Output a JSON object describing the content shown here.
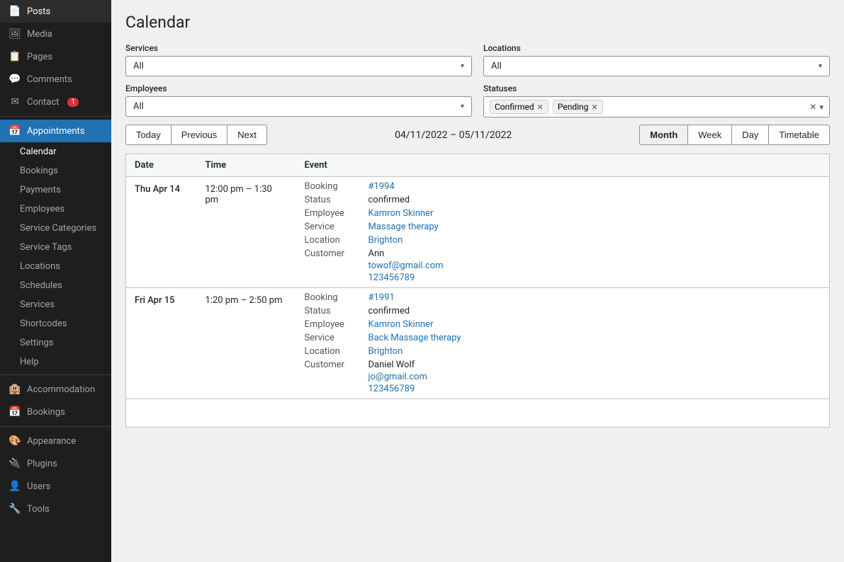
{
  "sidebar": {
    "items": [
      {
        "id": "posts",
        "label": "Posts",
        "icon": "📄",
        "active": false
      },
      {
        "id": "media",
        "label": "Media",
        "icon": "🖼",
        "active": false
      },
      {
        "id": "pages",
        "label": "Pages",
        "icon": "📋",
        "active": false
      },
      {
        "id": "comments",
        "label": "Comments",
        "icon": "💬",
        "active": false
      },
      {
        "id": "contact",
        "label": "Contact",
        "icon": "✉",
        "badge": "1",
        "active": false
      },
      {
        "id": "appointments",
        "label": "Appointments",
        "icon": "📅",
        "active": true
      }
    ],
    "appointments_sub": [
      {
        "id": "calendar",
        "label": "Calendar",
        "active": true
      },
      {
        "id": "bookings",
        "label": "Bookings",
        "active": false
      },
      {
        "id": "payments",
        "label": "Payments",
        "active": false
      },
      {
        "id": "employees",
        "label": "Employees",
        "active": false
      },
      {
        "id": "service-categories",
        "label": "Service Categories",
        "active": false
      },
      {
        "id": "service-tags",
        "label": "Service Tags",
        "active": false
      },
      {
        "id": "locations",
        "label": "Locations",
        "active": false
      },
      {
        "id": "schedules",
        "label": "Schedules",
        "active": false
      },
      {
        "id": "services",
        "label": "Services",
        "active": false
      },
      {
        "id": "shortcodes",
        "label": "Shortcodes",
        "active": false
      },
      {
        "id": "settings",
        "label": "Settings",
        "active": false
      },
      {
        "id": "help",
        "label": "Help",
        "active": false
      }
    ],
    "bottom_items": [
      {
        "id": "accommodation",
        "label": "Accommodation",
        "icon": "🏨"
      },
      {
        "id": "bookings2",
        "label": "Bookings",
        "icon": "📅"
      },
      {
        "id": "appearance",
        "label": "Appearance",
        "icon": "🎨"
      },
      {
        "id": "plugins",
        "label": "Plugins",
        "icon": "🔌"
      },
      {
        "id": "users",
        "label": "Users",
        "icon": "👤"
      },
      {
        "id": "tools",
        "label": "Tools",
        "icon": "🔧"
      }
    ]
  },
  "page": {
    "title": "Calendar"
  },
  "filters": {
    "services_label": "Services",
    "services_value": "All",
    "locations_label": "Locations",
    "locations_value": "All",
    "employees_label": "Employees",
    "employees_value": "All",
    "statuses_label": "Statuses",
    "status_tags": [
      "Confirmed",
      "Pending"
    ],
    "chevron": "▾"
  },
  "calendar_nav": {
    "today": "Today",
    "previous": "Previous",
    "next": "Next",
    "date_range": "04/11/2022 – 05/11/2022",
    "views": [
      "Month",
      "Week",
      "Day",
      "Timetable"
    ],
    "active_view": "Month"
  },
  "table": {
    "headers": [
      "Date",
      "Time",
      "Event"
    ],
    "rows": [
      {
        "date": "Thu Apr 14",
        "time": "12:00 pm – 1:30 pm",
        "events": [
          {
            "label": "Booking",
            "value": "#1994",
            "link": true
          },
          {
            "label": "Status",
            "value": "confirmed",
            "link": false
          },
          {
            "label": "Employee",
            "value": "Kamron Skinner",
            "link": true
          },
          {
            "label": "Service",
            "value": "Massage therapy",
            "link": true
          },
          {
            "label": "Location",
            "value": "Brighton",
            "link": true
          },
          {
            "label": "Customer",
            "value": "Ann\ntowof@gmail.com\n123456789",
            "link": false,
            "customer": {
              "name": "Ann",
              "email": "towof@gmail.com",
              "phone": "123456789"
            }
          }
        ]
      },
      {
        "date": "Fri Apr 15",
        "time": "1:20 pm – 2:50 pm",
        "events": [
          {
            "label": "Booking",
            "value": "#1991",
            "link": true
          },
          {
            "label": "Status",
            "value": "confirmed",
            "link": false
          },
          {
            "label": "Employee",
            "value": "Kamron Skinner",
            "link": true
          },
          {
            "label": "Service",
            "value": "Back Massage therapy",
            "link": true
          },
          {
            "label": "Location",
            "value": "Brighton",
            "link": true
          },
          {
            "label": "Customer",
            "value": "Daniel Wolf\njo@gmail.com\n123456789",
            "link": false,
            "customer": {
              "name": "Daniel Wolf",
              "email": "jo@gmail.com",
              "phone": "123456789"
            }
          }
        ]
      }
    ]
  }
}
